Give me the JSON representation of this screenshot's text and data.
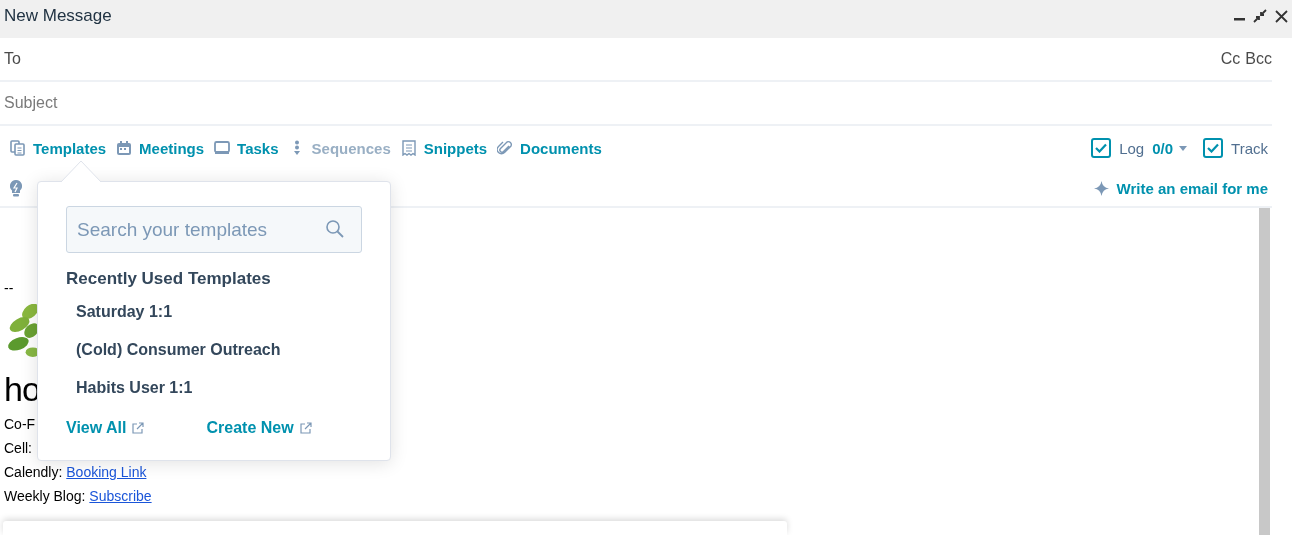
{
  "window": {
    "title": "New Message"
  },
  "recipients": {
    "label": "To",
    "cc": "Cc",
    "bcc": "Bcc"
  },
  "subject": {
    "placeholder": "Subject"
  },
  "toolbar": [
    {
      "kind": "templates",
      "label": "Templates",
      "disabled": false
    },
    {
      "kind": "meetings",
      "label": "Meetings",
      "disabled": false
    },
    {
      "kind": "tasks",
      "label": "Tasks",
      "disabled": false
    },
    {
      "kind": "sequences",
      "label": "Sequences",
      "disabled": true
    },
    {
      "kind": "snippets",
      "label": "Snippets",
      "disabled": false
    },
    {
      "kind": "documents",
      "label": "Documents",
      "disabled": false
    }
  ],
  "log": {
    "checked": true,
    "label": "Log",
    "count": "0/0"
  },
  "track": {
    "checked": true,
    "label": "Track"
  },
  "ai_button": "Write an email for me",
  "signature": {
    "separator": "--",
    "logo_text": "ho",
    "lines": [
      {
        "text": "Co-F"
      },
      {
        "text": "Cell:"
      },
      {
        "text": "Calendly:",
        "link": "Booking Link"
      },
      {
        "text": "Weekly Blog:",
        "link": "Subscribe"
      }
    ]
  },
  "templates_popup": {
    "search": {
      "placeholder": "Search your templates"
    },
    "heading": "Recently Used Templates",
    "items": [
      {
        "label": "Saturday 1:1"
      },
      {
        "label": "(Cold) Consumer Outreach"
      },
      {
        "label": "Habits User 1:1"
      }
    ],
    "links": [
      "View All",
      "Create New"
    ]
  }
}
